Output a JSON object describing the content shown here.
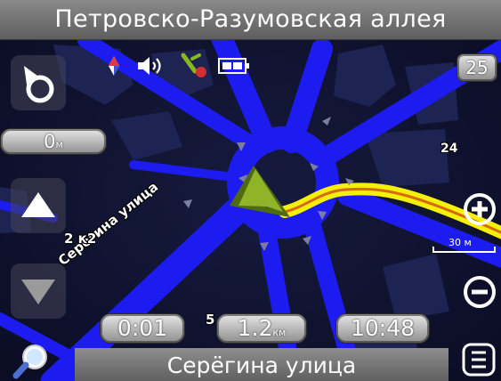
{
  "header": {
    "street": "Петровско-Разумовская аллея"
  },
  "footer": {
    "street": "Серёгина улица"
  },
  "map": {
    "street_label": "Серёгина улица",
    "house_labels": {
      "left": "2 к2",
      "right": "24",
      "bottom": "5"
    },
    "scale": "30 м"
  },
  "zoom_level": "25",
  "distance": {
    "value": "0",
    "unit": "м"
  },
  "trip": {
    "elapsed": "0:01",
    "next_value": "1.2",
    "next_unit": "км",
    "clock": "10:48"
  },
  "colors": {
    "road": "#1c1cf0",
    "route": "#f5f00a",
    "arrow": "#7ea21b",
    "background": "#0b0d24"
  },
  "icons": [
    "compass-icon",
    "volume-icon",
    "gps-signal-icon",
    "battery-icon",
    "north-up-icon",
    "zoom-in-icon",
    "zoom-out-icon",
    "search-icon",
    "menu-icon",
    "up-arrow-icon",
    "down-arrow-icon"
  ]
}
